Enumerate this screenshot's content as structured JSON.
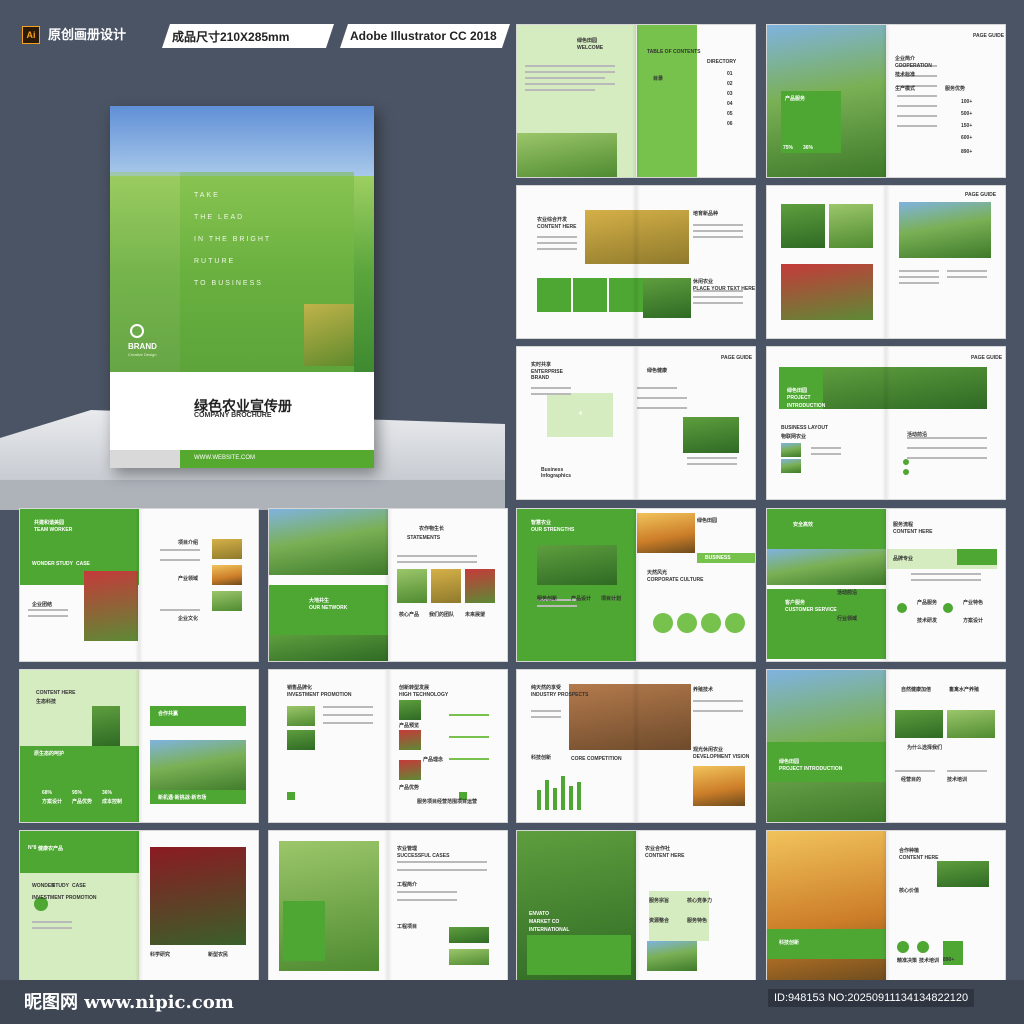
{
  "header": {
    "ai_label": "Ai",
    "title": "原创画册设计",
    "size_badge": "成品尺寸210X285mm",
    "software_badge": "Adobe Illustrator CC 2018"
  },
  "cover": {
    "taglines": [
      "TAKE",
      "THE LEAD",
      "IN THE BRIGHT",
      "RUTURE",
      "TO BUSINESS"
    ],
    "brand": "BRAND",
    "brand_sub": "Creative Design",
    "title": "绿色农业宣传册",
    "subtitle": "COMPANY BROCHURE",
    "url": "WWW.WEBSITE.COM"
  },
  "spreads": [
    {
      "labels": [
        "绿色田园",
        "WELCOME",
        "TABLE OF CONTENTS",
        "目录",
        "DIRECTORY",
        "01",
        "02",
        "03",
        "04",
        "05",
        "06"
      ]
    },
    {
      "labels": [
        "企业简介",
        "COOPERATION",
        "技术标准",
        "产品服务",
        "75%",
        "36%",
        "生产模式",
        "服务优势",
        "100+",
        "500+",
        "150+",
        "600+",
        "890+",
        "PAGE GUIDE"
      ]
    },
    {
      "labels": [
        "农业综合开发",
        "CONTENT HERE",
        "培育新品种",
        "休闲农业",
        "PLACE YOUR TEXT HERE"
      ]
    },
    {
      "labels": [
        "PAGE GUIDE"
      ]
    },
    {
      "labels": [
        "实时共享",
        "ENTERPRISE",
        "BRAND",
        "绿色健康",
        "4",
        "Business",
        "Infographics",
        "PAGE GUIDE"
      ]
    },
    {
      "labels": [
        "绿色田园",
        "PROJECT",
        "INTRODUCTION",
        "BUSINESS LAYOUT",
        "物联网农业",
        "活动前沿",
        "PAGE GUIDE"
      ]
    },
    {
      "labels": [
        "共建和谐美园",
        "TEAM WORKER",
        "WONDER",
        "STUDY",
        "CASE",
        "企业团结",
        "项目介绍",
        "产业领域",
        "企业文化"
      ]
    },
    {
      "labels": [
        "农作物生长",
        "STATEMENTS",
        "大地共生",
        "OUR NETWORK",
        "核心产品",
        "我们的团队",
        "未来展望"
      ]
    },
    {
      "labels": [
        "智慧农业",
        "OUR STRENGTHS",
        "绿色田园",
        "BUSINESS",
        "天然风光",
        "CORPORATE CULTURE",
        "服务创新",
        "产品设计",
        "项目计划"
      ]
    },
    {
      "labels": [
        "安全高效",
        "服务流程",
        "CONTENT HERE",
        "品牌专业",
        "客户服务",
        "CUSTOMER SERVICE",
        "活动前沿",
        "产品服务",
        "产业特色",
        "技术研发",
        "行业领域",
        "方案设计"
      ]
    },
    {
      "labels": [
        "CONTENT HERE",
        "生态科技",
        "合作共赢",
        "原生态的呵护",
        "新机遇·新挑战·新市场",
        "68%",
        "95%",
        "36%",
        "方案设计",
        "产品优势",
        "成本控制"
      ]
    },
    {
      "labels": [
        "销售品牌化",
        "INVESTMENT PROMOTION",
        "创新转型发展",
        "HIGH TECHNOLOGY",
        "产品预览",
        "产品理念",
        "产品优势",
        "服务项目",
        "经营范围",
        "项目运营"
      ]
    },
    {
      "labels": [
        "纯天然的享受",
        "INDUSTRY PROSPECTS",
        "养殖技术",
        "科技创新",
        "CORE COMPETITION",
        "观光休闲农业",
        "DEVELOPMENT VISION"
      ]
    },
    {
      "labels": [
        "自然健康加倍",
        "畜禽水产养殖",
        "绿色田园",
        "PROJECT INTRODUCTION",
        "为什么选择我们",
        "经营目的",
        "技术培训"
      ]
    },
    {
      "labels": [
        "N°8",
        "健康农产品",
        "WONDER",
        "STUDY",
        "CASE",
        "INVESTMENT PROMOTION",
        "科学研究",
        "新型农民"
      ]
    },
    {
      "labels": [
        "农业管理",
        "SUCCESSFUL CASES",
        "工程简介",
        "工程项目"
      ]
    },
    {
      "labels": [
        "农业合作社",
        "CONTENT HERE",
        "ENVATO",
        "MARKET CO",
        "INTERNATIONAL",
        "服务宗旨",
        "核心竞争力",
        "资源整合",
        "服务特色"
      ]
    },
    {
      "labels": [
        "合作种植",
        "CONTENT HERE",
        "核心价值",
        "科技创新",
        "精准决策",
        "技术培训",
        "890+"
      ]
    }
  ],
  "footer": {
    "site": "昵图网 www.nipic.com",
    "id": "ID:948153 NO:20250911134134822120"
  },
  "colors": {
    "accent": "#4da732",
    "light_accent": "#77c24d",
    "background": "#4b5464"
  }
}
